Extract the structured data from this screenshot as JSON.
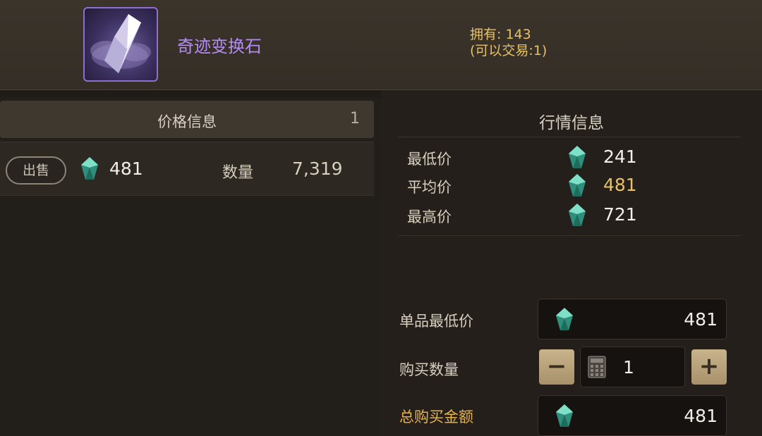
{
  "item": {
    "name": "奇迹变换石",
    "owned_label": "拥有:",
    "owned_count": "143",
    "tradable_text": "(可以交易:1)"
  },
  "price_info": {
    "title": "价格信息",
    "page": "1",
    "listings": [
      {
        "action_label": "出售",
        "price": "481",
        "qty_label": "数量",
        "qty": "7,319"
      }
    ]
  },
  "market_info": {
    "title": "行情信息",
    "stats": [
      {
        "label": "最低价",
        "value": "241"
      },
      {
        "label": "平均价",
        "value": "481"
      },
      {
        "label": "最高价",
        "value": "721"
      }
    ]
  },
  "purchase": {
    "unit_price_label": "单品最低价",
    "unit_price": "481",
    "quantity_label": "购买数量",
    "quantity": "1",
    "minus_label": "−",
    "plus_label": "+",
    "total_label": "总购买金额",
    "total": "481"
  },
  "colors": {
    "item_name": "#b58cf0",
    "gold_text": "#e6c16a",
    "total_label": "#e6b24a",
    "gem": "#3fb59a"
  },
  "icons": {
    "item": "crystal-shard-icon",
    "currency": "blue-gem-icon",
    "calculator": "calculator-icon"
  }
}
